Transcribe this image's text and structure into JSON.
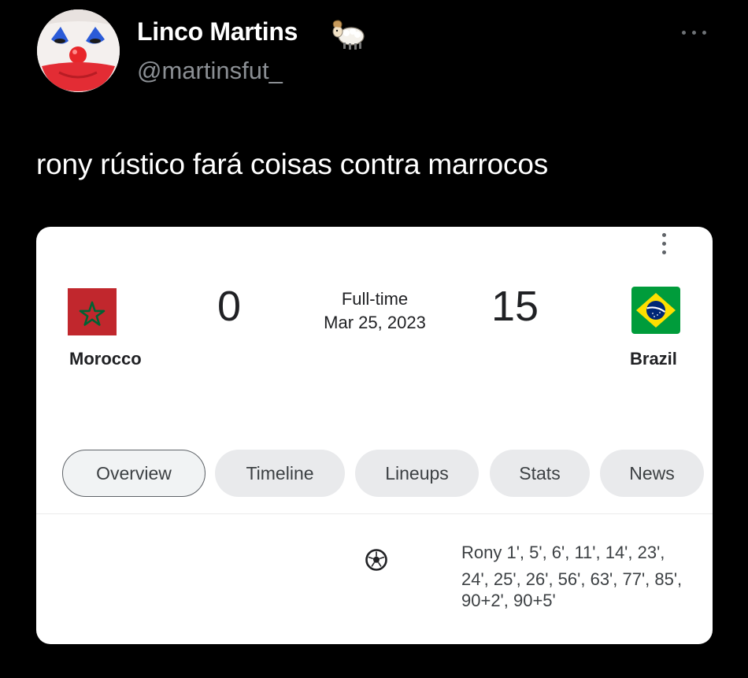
{
  "tweet": {
    "author": {
      "name": "Linco Martins",
      "handle": "@martinsfut_",
      "avatar_icon": "clown-face-avatar",
      "badge_icon": "ram-emoji-icon"
    },
    "text": "rony rústico fará coisas contra marrocos",
    "menu_icon": "more-horizontal-icon",
    "colors": {
      "background": "#000000",
      "name": "#ffffff",
      "handle": "#8b8f94"
    }
  },
  "match": {
    "home": {
      "name": "Morocco",
      "score": "0",
      "flag_icon": "morocco-flag-icon"
    },
    "away": {
      "name": "Brazil",
      "score": "15",
      "flag_icon": "brazil-flag-icon"
    },
    "status": "Full-time",
    "date": "Mar 25, 2023",
    "menu_icon": "more-vertical-icon",
    "tabs": [
      {
        "label": "Overview",
        "active": true
      },
      {
        "label": "Timeline",
        "active": false
      },
      {
        "label": "Lineups",
        "active": false
      },
      {
        "label": "Stats",
        "active": false
      },
      {
        "label": "News",
        "active": false
      }
    ],
    "goals": {
      "icon": "soccer-ball-icon",
      "lines": [
        "Rony 1', 5', 6', 11', 14', 23',",
        "24', 25', 26', 56', 63', 77', 85',",
        "90+2', 90+5'"
      ]
    }
  }
}
